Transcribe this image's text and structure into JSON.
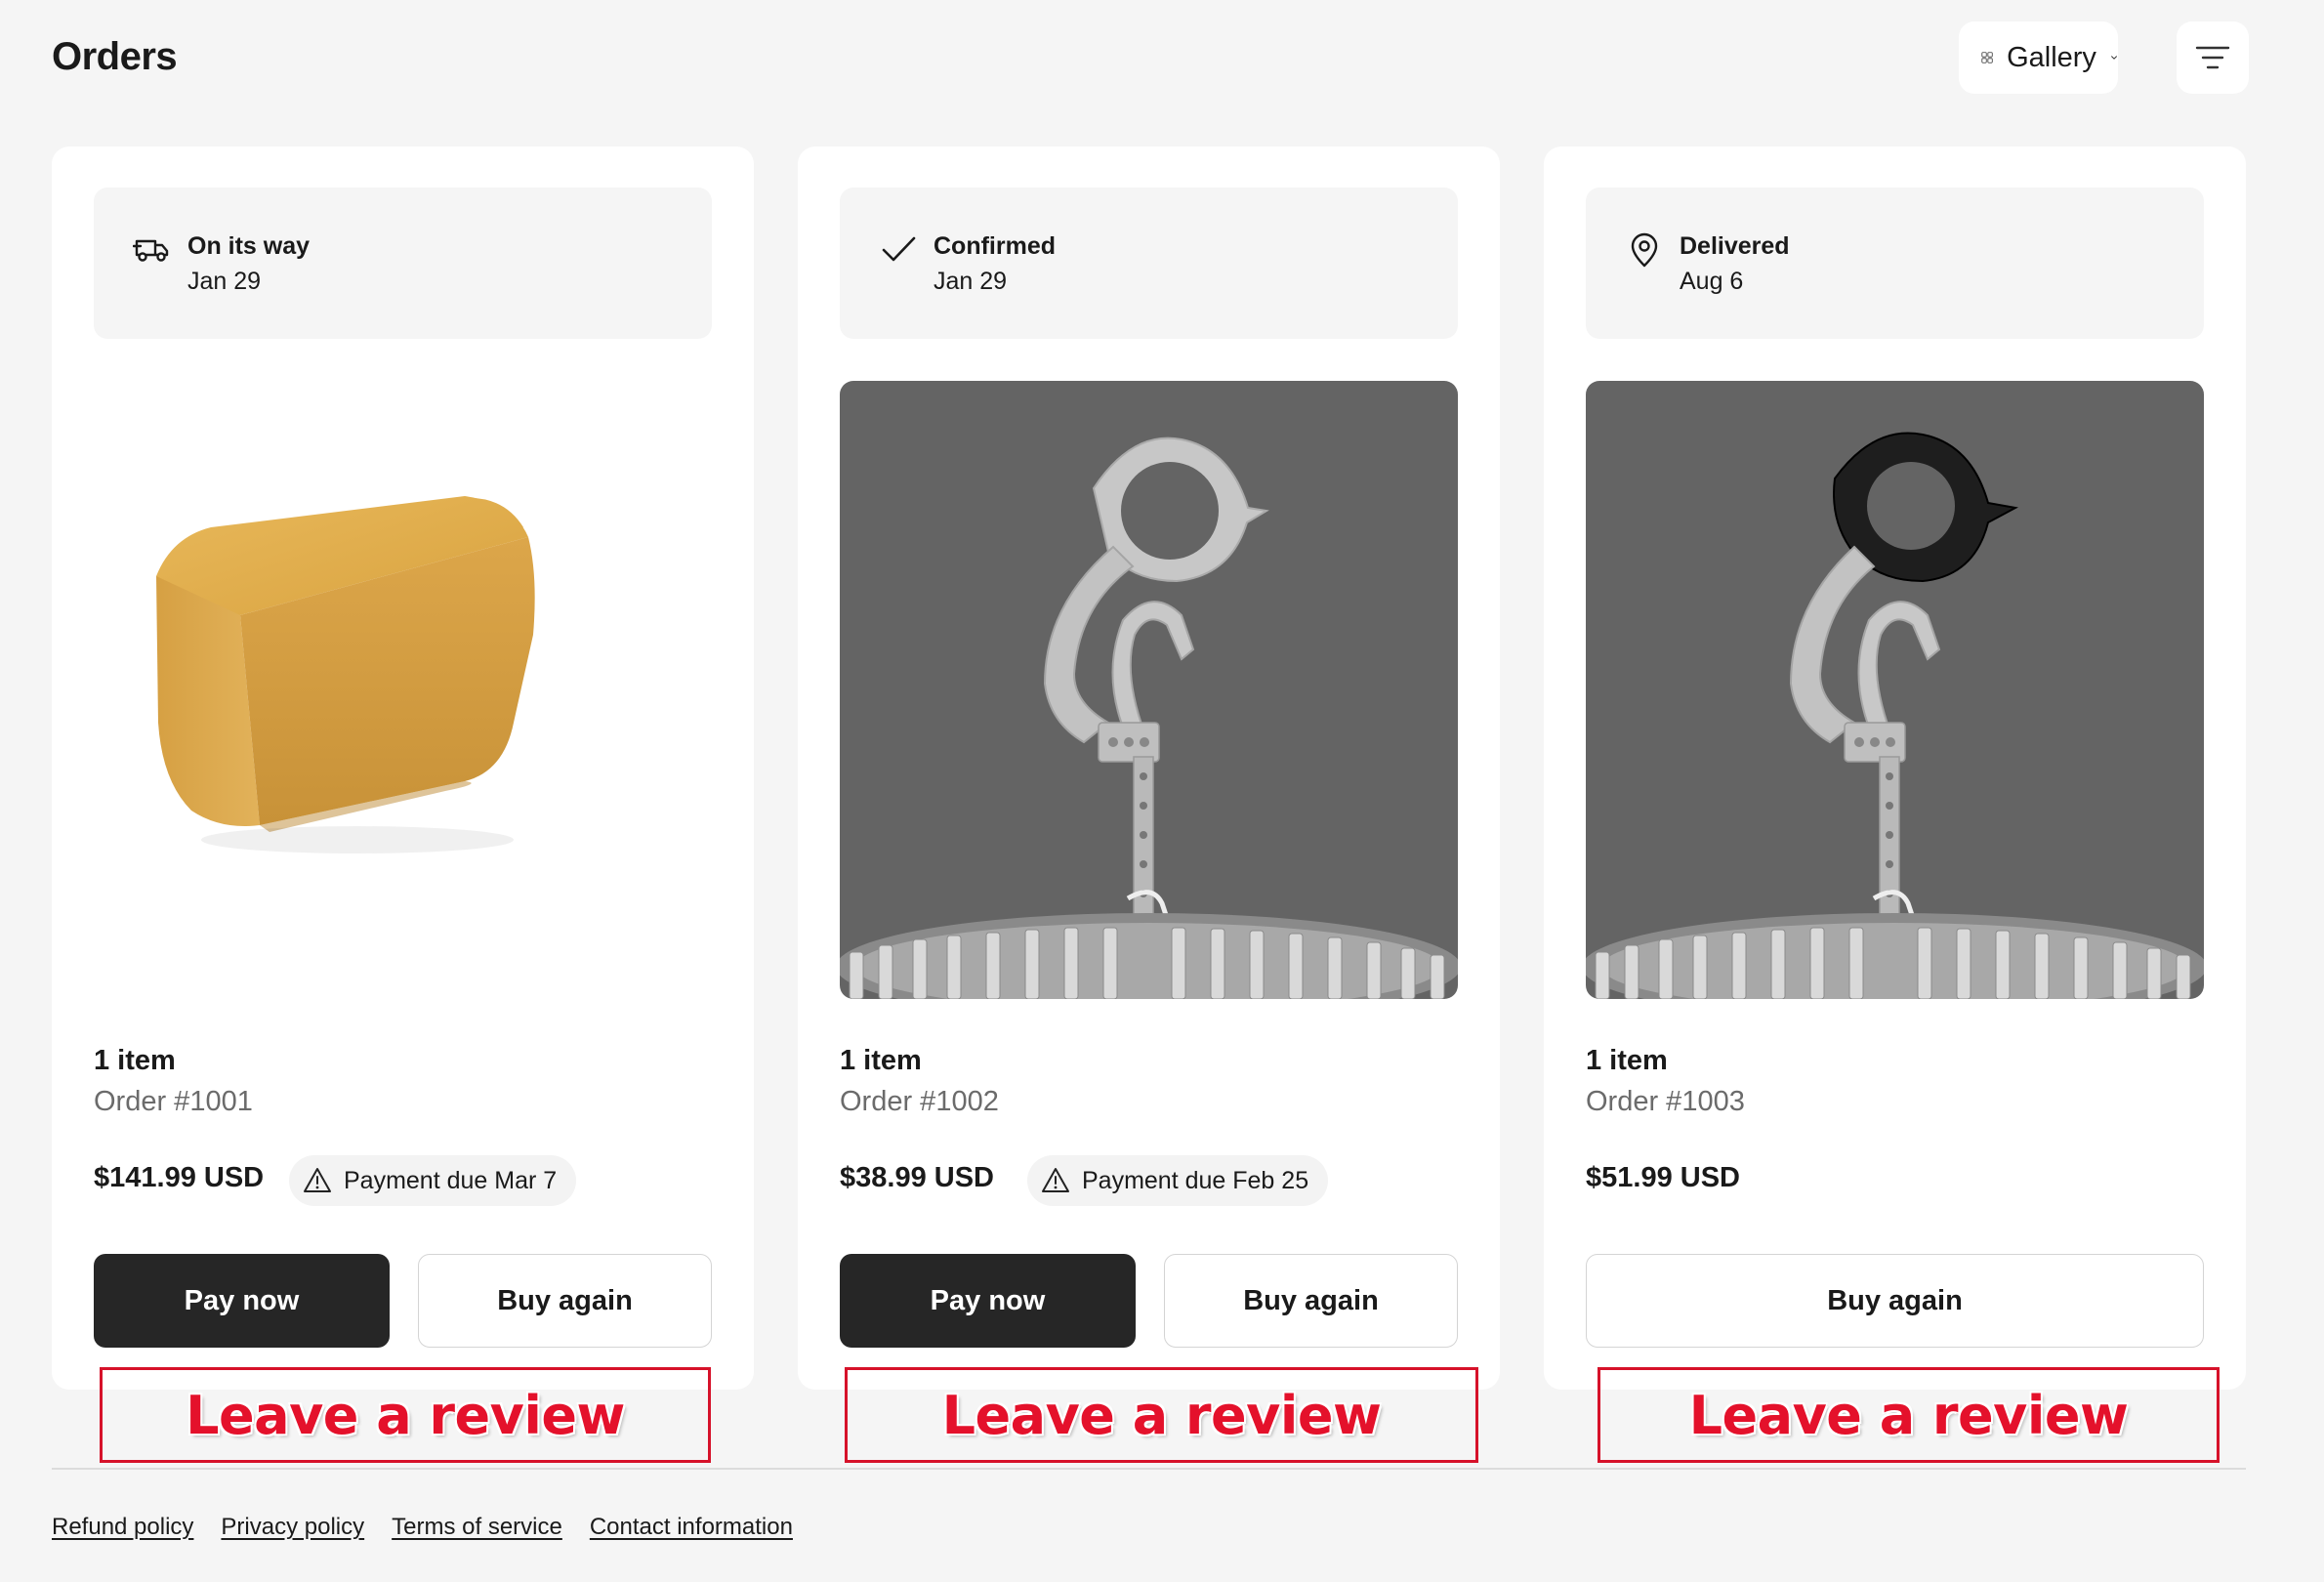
{
  "header": {
    "title": "Orders",
    "view_switch": {
      "label": "Gallery",
      "icon": "grid-icon",
      "chevron": "chevron-down-icon"
    },
    "filter_icon": "filter-icon"
  },
  "orders": [
    {
      "status": "On its way",
      "status_icon": "truck-icon",
      "date": "Jan 29",
      "item_count": "1 item",
      "order_number": "Order #1001",
      "price": "$141.99 USD",
      "payment_note": "Payment due Mar 7",
      "image": "beeswax-block",
      "primary_button": "Pay now",
      "secondary_button": "Buy again",
      "review_label": "Leave a review"
    },
    {
      "status": "Confirmed",
      "status_icon": "check-icon",
      "date": "Jan 29",
      "item_count": "1 item",
      "order_number": "Order #1002",
      "price": "$38.99 USD",
      "payment_note": "Payment due Feb 25",
      "image": "metal-hanger",
      "primary_button": "Pay now",
      "secondary_button": "Buy again",
      "review_label": "Leave a review"
    },
    {
      "status": "Delivered",
      "status_icon": "location-pin-icon",
      "date": "Aug 6",
      "item_count": "1 item",
      "order_number": "Order #1003",
      "price": "$51.99 USD",
      "image": "metal-hanger-black-grip",
      "secondary_button": "Buy again",
      "review_label": "Leave a review"
    }
  ],
  "footer": {
    "links": [
      "Refund policy",
      "Privacy policy",
      "Terms of service",
      "Contact information"
    ]
  },
  "colors": {
    "background": "#f5f5f5",
    "card": "#ffffff",
    "primary_button": "#262626",
    "review_annotation": "#e4112b",
    "product_gray": "#646464"
  }
}
